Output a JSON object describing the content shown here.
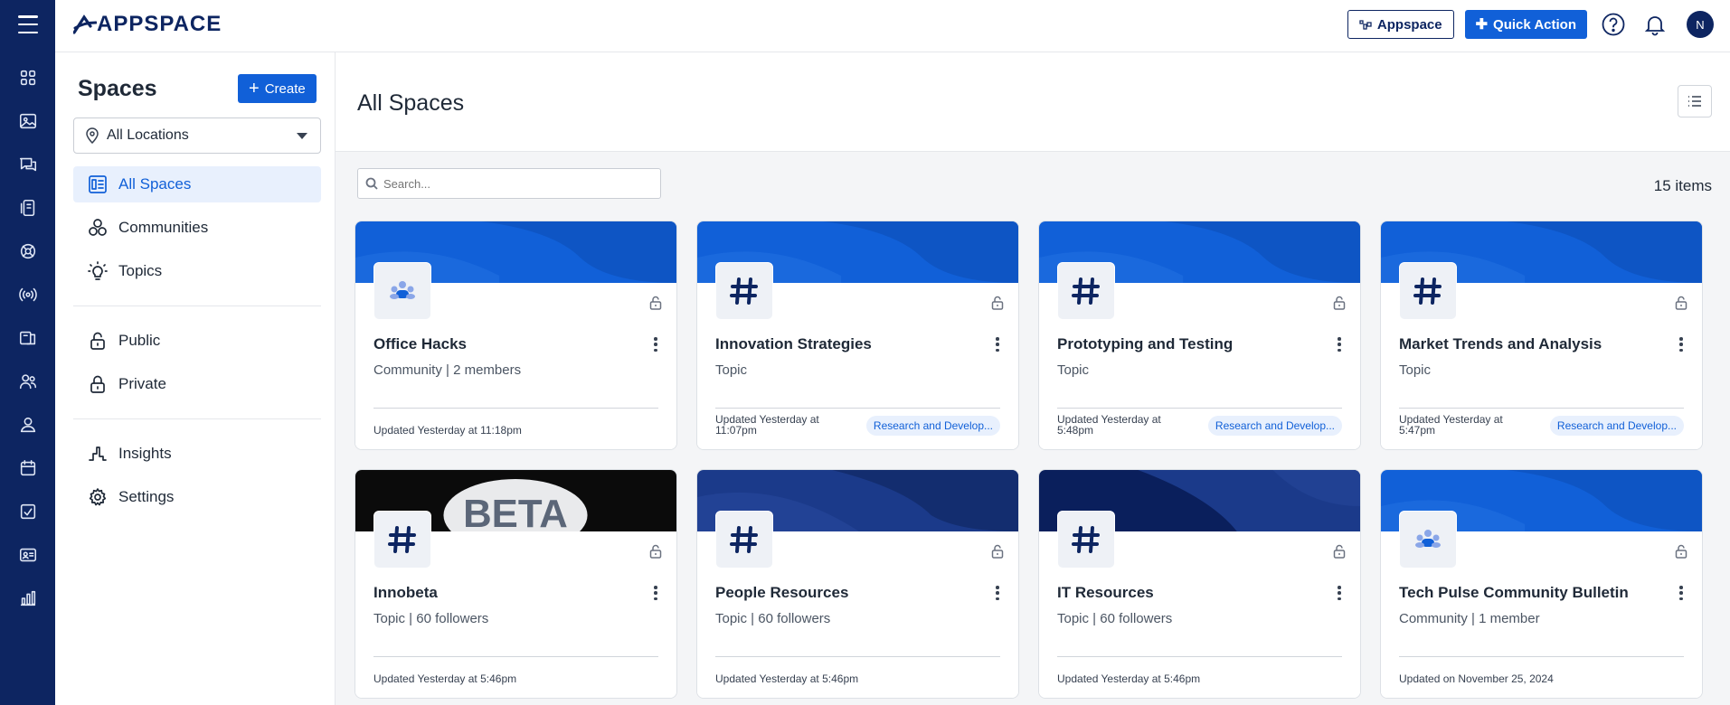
{
  "app": {
    "logo_text": "APPSPACE"
  },
  "topbar": {
    "appspace_button": "Appspace",
    "quick_action_button": "Quick Action",
    "avatar_initial": "N"
  },
  "sidebar": {
    "title": "Spaces",
    "create_label": "Create",
    "location_select": "All Locations",
    "items": [
      {
        "label": "All Spaces",
        "icon": "spaces-grid-icon",
        "active": true
      },
      {
        "label": "Communities",
        "icon": "communities-icon"
      },
      {
        "label": "Topics",
        "icon": "lightbulb-icon"
      },
      {
        "label": "Public",
        "icon": "unlock-icon"
      },
      {
        "label": "Private",
        "icon": "lock-icon"
      },
      {
        "label": "Insights",
        "icon": "insights-icon"
      },
      {
        "label": "Settings",
        "icon": "gear-icon"
      }
    ]
  },
  "main": {
    "title": "All Spaces",
    "search_placeholder": "Search...",
    "item_count": "15 items"
  },
  "cards": [
    {
      "title": "Office Hacks",
      "meta": "Community | 2 members",
      "updated": "Updated Yesterday at 11:18pm",
      "tag": "",
      "kind": "community",
      "banner": "blue"
    },
    {
      "title": "Innovation Strategies",
      "meta": "Topic",
      "updated": "Updated Yesterday at 11:07pm",
      "tag": "Research and Develop...",
      "kind": "topic",
      "banner": "blue"
    },
    {
      "title": "Prototyping and Testing",
      "meta": "Topic",
      "updated": "Updated Yesterday at 5:48pm",
      "tag": "Research and Develop...",
      "kind": "topic",
      "banner": "blue"
    },
    {
      "title": "Market Trends and Analysis",
      "meta": "Topic",
      "updated": "Updated Yesterday at 5:47pm",
      "tag": "Research and Develop...",
      "kind": "topic",
      "banner": "blue"
    },
    {
      "title": "Innobeta",
      "meta": "Topic | 60 followers",
      "updated": "Updated Yesterday at 5:46pm",
      "tag": "",
      "kind": "topic",
      "banner": "beta",
      "banner_text": "BETA"
    },
    {
      "title": "People Resources",
      "meta": "Topic | 60 followers",
      "updated": "Updated Yesterday at 5:46pm",
      "tag": "",
      "kind": "topic",
      "banner": "navy"
    },
    {
      "title": "IT Resources",
      "meta": "Topic | 60 followers",
      "updated": "Updated Yesterday at 5:46pm",
      "tag": "",
      "kind": "topic",
      "banner": "navy2"
    },
    {
      "title": "Tech Pulse Community Bulletin",
      "meta": "Community | 1 member",
      "updated": "Updated on November 25, 2024",
      "tag": "",
      "kind": "community",
      "banner": "blue"
    }
  ],
  "colors": {
    "rail": "#0d2561",
    "accent": "#1160d8",
    "active_bg": "#e8f0fd"
  }
}
